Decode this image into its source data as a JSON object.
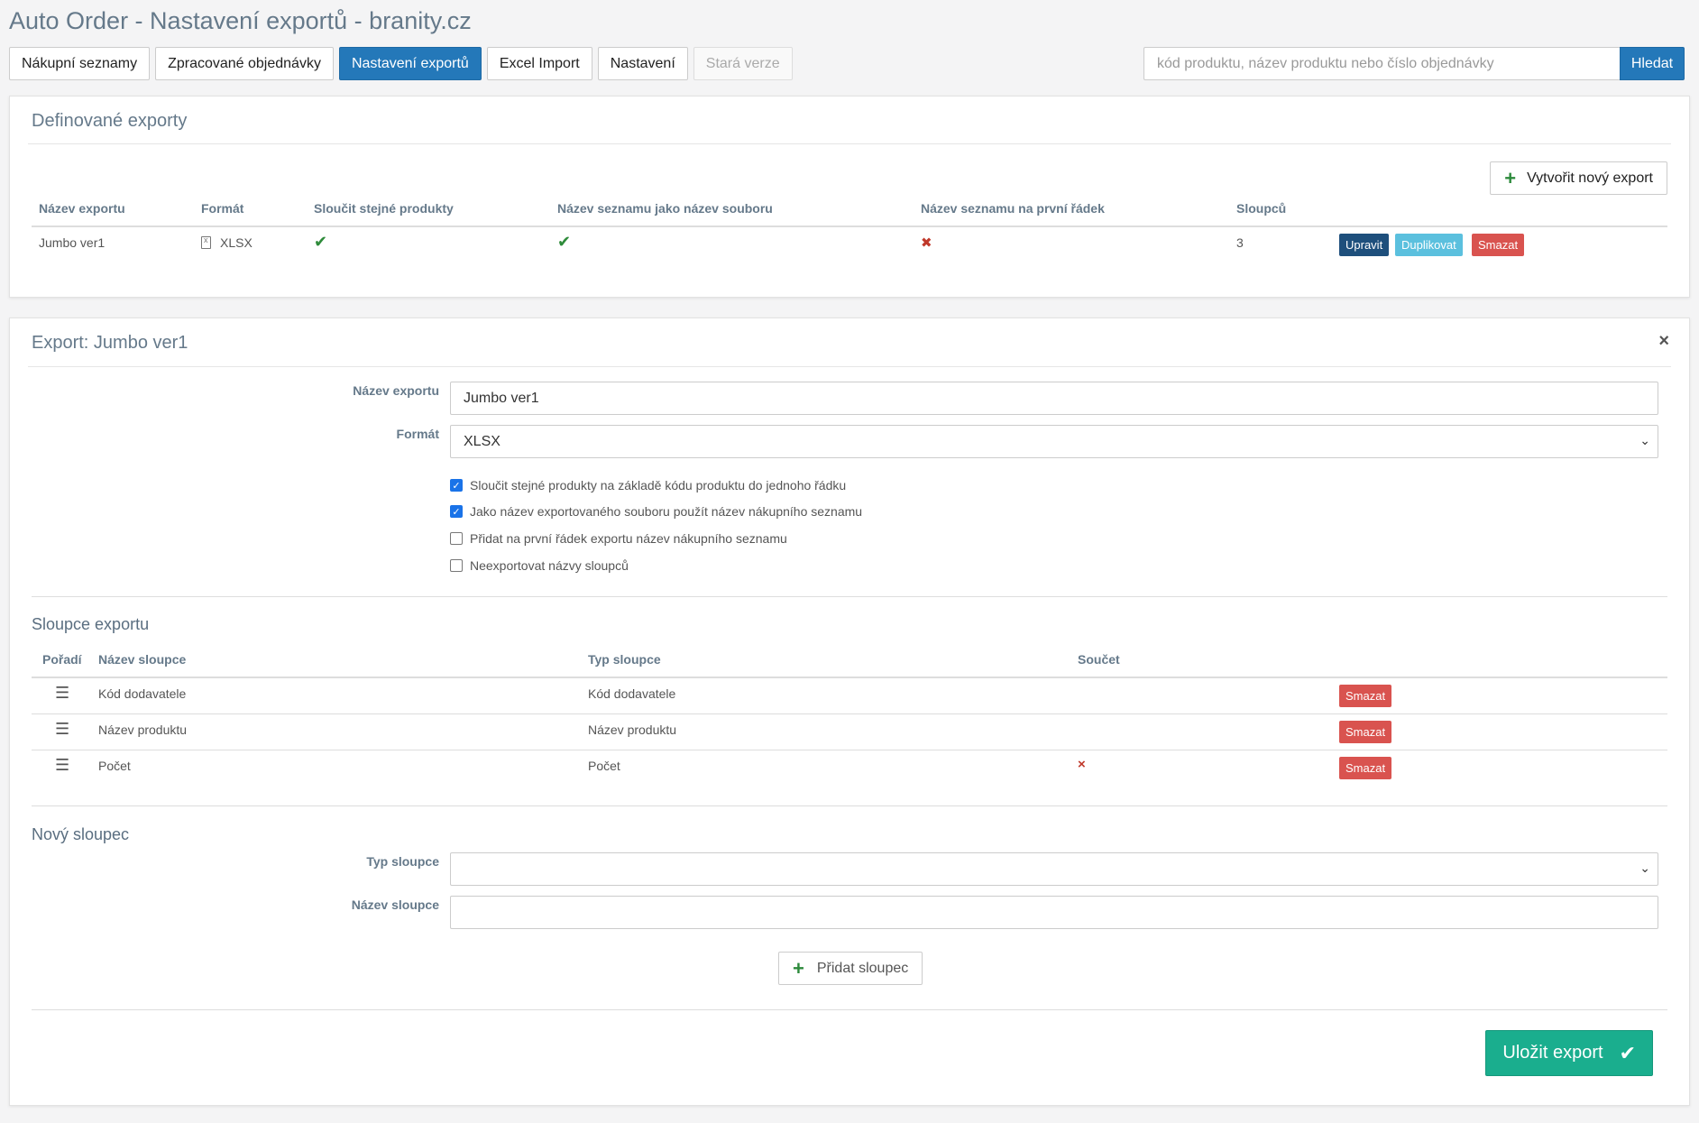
{
  "page": {
    "title": "Auto Order - Nastavení exportů - branity.cz"
  },
  "nav": [
    {
      "label": "Nákupní seznamy",
      "state": "normal"
    },
    {
      "label": "Zpracované objednávky",
      "state": "normal"
    },
    {
      "label": "Nastavení exportů",
      "state": "active"
    },
    {
      "label": "Excel Import",
      "state": "normal"
    },
    {
      "label": "Nastavení",
      "state": "normal"
    },
    {
      "label": "Stará verze",
      "state": "disabled"
    }
  ],
  "search": {
    "placeholder": "kód produktu, název produktu nebo číslo objednávky",
    "value": "",
    "button": "Hledat"
  },
  "exports_panel": {
    "title": "Definované exporty",
    "create_button": "Vytvořit nový export",
    "headers": [
      "Název exportu",
      "Formát",
      "Sloučit stejné produkty",
      "Název seznamu jako název souboru",
      "Název seznamu na první řádek",
      "Sloupců"
    ],
    "rows": [
      {
        "name": "Jumbo ver1",
        "format": "XLSX",
        "merge": true,
        "list_as_filename": true,
        "list_first_row": false,
        "columns": "3",
        "actions": {
          "edit": "Upravit",
          "duplicate": "Duplikovat",
          "delete": "Smazat"
        }
      }
    ]
  },
  "edit_panel": {
    "title": "Export: Jumbo ver1",
    "close": "×",
    "name_label": "Název exportu",
    "name_value": "Jumbo ver1",
    "format_label": "Formát",
    "format_value": "XLSX",
    "checkboxes": [
      {
        "label": "Sloučit stejné produkty na základě kódu produktu do jednoho řádku",
        "checked": true
      },
      {
        "label": "Jako název exportovaného souboru použít název nákupního seznamu",
        "checked": true
      },
      {
        "label": "Přidat na první řádek exportu název nákupního seznamu",
        "checked": false
      },
      {
        "label": "Neexportovat názvy sloupců",
        "checked": false
      }
    ],
    "columns_section": {
      "title": "Sloupce exportu",
      "headers": [
        "Pořadí",
        "Název sloupce",
        "Typ sloupce",
        "Součet"
      ],
      "rows": [
        {
          "name": "Kód dodavatele",
          "type": "Kód dodavatele",
          "sum": "",
          "delete": "Smazat"
        },
        {
          "name": "Název produktu",
          "type": "Název produktu",
          "sum": "",
          "delete": "Smazat"
        },
        {
          "name": "Počet",
          "type": "Počet",
          "sum": "×",
          "delete": "Smazat"
        }
      ]
    },
    "new_column": {
      "title": "Nový sloupec",
      "type_label": "Typ sloupce",
      "type_value": "",
      "name_label": "Název sloupce",
      "name_value": "",
      "add_button": "Přidat sloupec"
    },
    "save_button": "Uložit export"
  }
}
